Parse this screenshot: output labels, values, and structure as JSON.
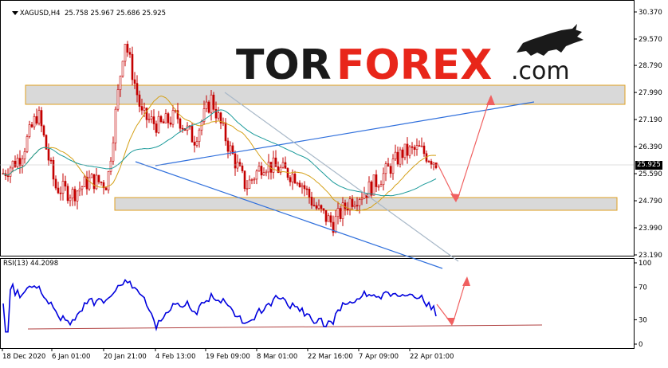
{
  "header": {
    "symbol_tf": "XAGUSD,H4",
    "ohlc": "25.758 25.967 25.686 25.925"
  },
  "logo": {
    "part1": "TOR",
    "part2": "FOREX",
    "part3": ".com",
    "color_dark": "#1a1a1a",
    "color_accent": "#e8261a"
  },
  "price_axis": {
    "ticks": [
      "30.370",
      "29.570",
      "28.790",
      "27.990",
      "27.190",
      "26.390",
      "25.590",
      "24.790",
      "23.990",
      "23.190"
    ],
    "current": "25.925"
  },
  "rsi": {
    "label": "RSI(13) 44.2098",
    "ticks": [
      "100",
      "70",
      "30",
      "0"
    ]
  },
  "time_axis": {
    "labels": [
      "18 Dec 2020",
      "6 Jan 01:00",
      "20 Jan 21:00",
      "4 Feb 13:00",
      "19 Feb 09:00",
      "8 Mar 01:00",
      "22 Mar 16:00",
      "7 Apr 09:00",
      "22 Apr 01:00"
    ]
  },
  "colors": {
    "candle": "#c40000",
    "ma_fast": "#d4a017",
    "ma_slow": "#1a9a9a",
    "trend_blue": "#2f6fdc",
    "trend_gray": "#a8b8c8",
    "rsi_line": "#0000dd",
    "rsi_support": "#b04040",
    "forecast_arrow": "#f06060",
    "zone_fill": "#d9d9d9",
    "zone_border": "#e0a020"
  },
  "chart_data": {
    "type": "candlestick",
    "symbol": "XAGUSD",
    "timeframe": "H4",
    "ylim": [
      23.19,
      30.37
    ],
    "current_price": 25.925,
    "resistance_zone": [
      27.85,
      28.3
    ],
    "support_zone": [
      24.55,
      24.95
    ],
    "close_path": [
      {
        "t": "18 Dec 2020",
        "y": 25.6
      },
      {
        "t": "",
        "y": 26.1
      },
      {
        "t": "",
        "y": 27.4
      },
      {
        "t": "6 Jan 01:00",
        "y": 25.2
      },
      {
        "t": "",
        "y": 25.0
      },
      {
        "t": "",
        "y": 25.4
      },
      {
        "t": "20 Jan 21:00",
        "y": 25.3
      },
      {
        "t": "",
        "y": 29.6
      },
      {
        "t": "",
        "y": 27.3
      },
      {
        "t": "4 Feb 13:00",
        "y": 27.0
      },
      {
        "t": "",
        "y": 27.3
      },
      {
        "t": "",
        "y": 26.6
      },
      {
        "t": "19 Feb 09:00",
        "y": 27.8
      },
      {
        "t": "",
        "y": 26.4
      },
      {
        "t": "",
        "y": 25.2
      },
      {
        "t": "8 Mar 01:00",
        "y": 25.9
      },
      {
        "t": "",
        "y": 25.7
      },
      {
        "t": "",
        "y": 25.5
      },
      {
        "t": "22 Mar 16:00",
        "y": 24.6
      },
      {
        "t": "",
        "y": 24.1
      },
      {
        "t": "",
        "y": 24.8
      },
      {
        "t": "7 Apr 09:00",
        "y": 25.1
      },
      {
        "t": "",
        "y": 25.6
      },
      {
        "t": "",
        "y": 26.2
      },
      {
        "t": "22 Apr 01:00",
        "y": 26.3
      },
      {
        "t": "",
        "y": 25.925
      }
    ],
    "forecast_path": [
      25.925,
      24.7,
      28.1
    ],
    "rsi": {
      "period": 13,
      "value": 44.2098,
      "ylim": [
        0,
        100
      ],
      "levels": [
        30,
        70
      ],
      "forecast_path": [
        44.2,
        27,
        77
      ]
    }
  }
}
